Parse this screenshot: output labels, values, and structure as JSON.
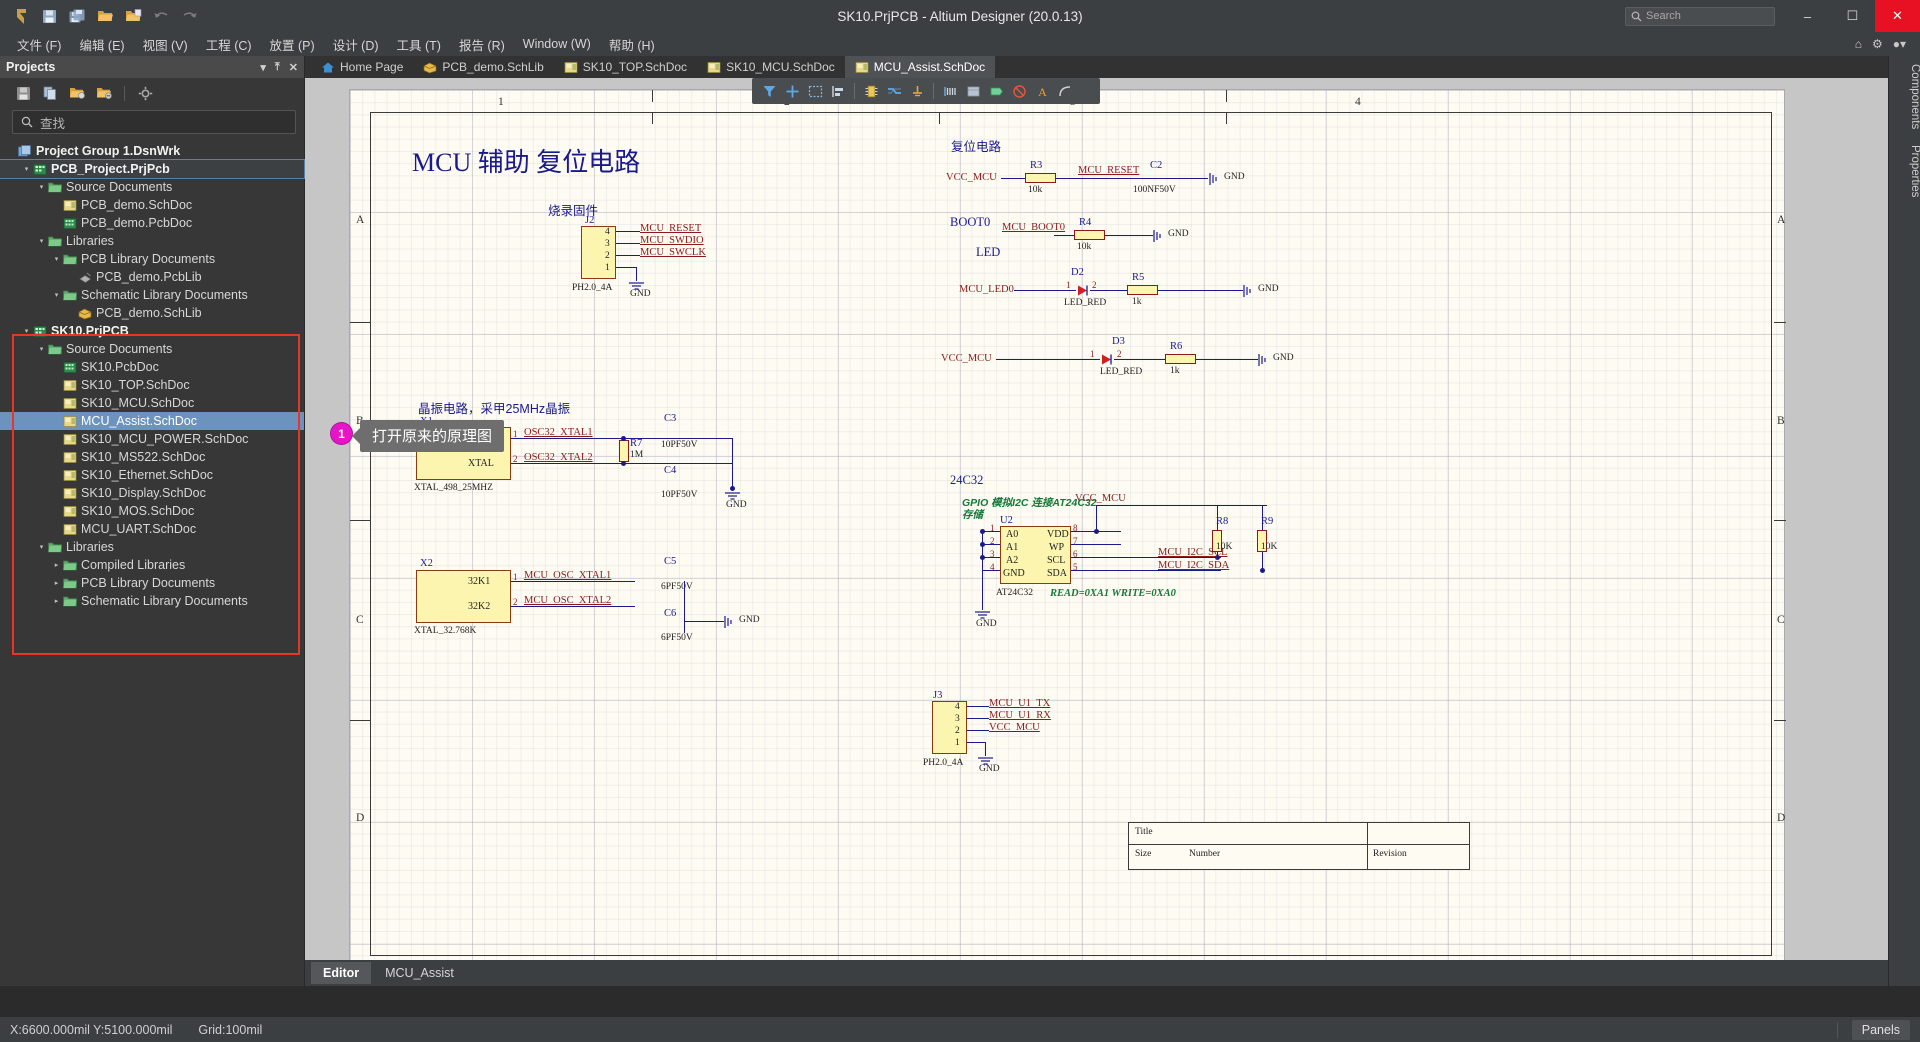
{
  "window": {
    "title": "SK10.PrjPCB - Altium Designer (20.0.13)",
    "search_placeholder": "Search",
    "minimize": "–",
    "maximize": "☐",
    "close": "✕"
  },
  "quick_toolbar": [
    {
      "name": "altium-logo-icon",
      "label": "A"
    },
    {
      "name": "save-icon",
      "label": "Save"
    },
    {
      "name": "save-all-icon",
      "label": "Save All"
    },
    {
      "name": "open-folder-icon",
      "label": "Open"
    },
    {
      "name": "open-project-icon",
      "label": "Open Project"
    },
    {
      "name": "undo-icon",
      "label": "Undo"
    },
    {
      "name": "redo-icon",
      "label": "Redo"
    }
  ],
  "menu": {
    "items": [
      "文件 (F)",
      "编辑 (E)",
      "视图 (V)",
      "工程 (C)",
      "放置 (P)",
      "设计 (D)",
      "工具 (T)",
      "报告 (R)",
      "Window (W)",
      "帮助 (H)"
    ]
  },
  "panel": {
    "title": "Projects",
    "header_controls": [
      "▾",
      "⤒",
      "✕"
    ],
    "toolbar_icons": [
      "save-icon",
      "copy-icon",
      "open-folder-add-icon",
      "open-folder-minus-icon",
      "gear-icon"
    ],
    "search_placeholder": "查找",
    "tree": [
      {
        "depth": 0,
        "label": "Project Group 1.DsnWrk",
        "icon": "workspace-icon",
        "bold": true,
        "arrow": "",
        "state": "normal"
      },
      {
        "depth": 1,
        "label": "PCB_Project.PrjPcb",
        "icon": "pcb-project-icon",
        "bold": true,
        "arrow": "▾",
        "state": "outlined"
      },
      {
        "depth": 2,
        "label": "Source Documents",
        "icon": "folder-icon",
        "bold": false,
        "arrow": "▾",
        "state": "normal"
      },
      {
        "depth": 3,
        "label": "PCB_demo.SchDoc",
        "icon": "schdoc-icon",
        "bold": false,
        "arrow": "",
        "state": "normal"
      },
      {
        "depth": 3,
        "label": "PCB_demo.PcbDoc",
        "icon": "pcbdoc-icon",
        "bold": false,
        "arrow": "",
        "state": "normal"
      },
      {
        "depth": 2,
        "label": "Libraries",
        "icon": "folder-icon",
        "bold": false,
        "arrow": "▾",
        "state": "normal"
      },
      {
        "depth": 3,
        "label": "PCB Library Documents",
        "icon": "folder-icon",
        "bold": false,
        "arrow": "▾",
        "state": "normal"
      },
      {
        "depth": 4,
        "label": "PCB_demo.PcbLib",
        "icon": "pcblib-icon",
        "bold": false,
        "arrow": "",
        "state": "normal"
      },
      {
        "depth": 3,
        "label": "Schematic Library Documents",
        "icon": "folder-icon",
        "bold": false,
        "arrow": "▾",
        "state": "normal"
      },
      {
        "depth": 4,
        "label": "PCB_demo.SchLib",
        "icon": "schlib-icon",
        "bold": false,
        "arrow": "",
        "state": "normal"
      },
      {
        "depth": 1,
        "label": "SK10.PrjPCB",
        "icon": "pcb-project-icon",
        "bold": true,
        "arrow": "▾",
        "state": "normal"
      },
      {
        "depth": 2,
        "label": "Source Documents",
        "icon": "folder-icon",
        "bold": false,
        "arrow": "▾",
        "state": "normal"
      },
      {
        "depth": 3,
        "label": "SK10.PcbDoc",
        "icon": "pcbdoc-icon",
        "bold": false,
        "arrow": "",
        "state": "normal"
      },
      {
        "depth": 3,
        "label": "SK10_TOP.SchDoc",
        "icon": "schdoc-icon",
        "bold": false,
        "arrow": "",
        "state": "normal"
      },
      {
        "depth": 3,
        "label": "SK10_MCU.SchDoc",
        "icon": "schdoc-icon",
        "bold": false,
        "arrow": "",
        "state": "normal"
      },
      {
        "depth": 3,
        "label": "MCU_Assist.SchDoc",
        "icon": "schdoc-icon",
        "bold": false,
        "arrow": "",
        "state": "selected"
      },
      {
        "depth": 3,
        "label": "SK10_MCU_POWER.SchDoc",
        "icon": "schdoc-icon",
        "bold": false,
        "arrow": "",
        "state": "normal"
      },
      {
        "depth": 3,
        "label": "SK10_MS522.SchDoc",
        "icon": "schdoc-icon",
        "bold": false,
        "arrow": "",
        "state": "normal"
      },
      {
        "depth": 3,
        "label": "SK10_Ethernet.SchDoc",
        "icon": "schdoc-icon",
        "bold": false,
        "arrow": "",
        "state": "normal"
      },
      {
        "depth": 3,
        "label": "SK10_Display.SchDoc",
        "icon": "schdoc-icon",
        "bold": false,
        "arrow": "",
        "state": "normal"
      },
      {
        "depth": 3,
        "label": "SK10_MOS.SchDoc",
        "icon": "schdoc-icon",
        "bold": false,
        "arrow": "",
        "state": "normal"
      },
      {
        "depth": 3,
        "label": "MCU_UART.SchDoc",
        "icon": "schdoc-icon",
        "bold": false,
        "arrow": "",
        "state": "normal"
      },
      {
        "depth": 2,
        "label": "Libraries",
        "icon": "folder-icon",
        "bold": false,
        "arrow": "▾",
        "state": "normal"
      },
      {
        "depth": 3,
        "label": "Compiled Libraries",
        "icon": "folder-icon",
        "bold": false,
        "arrow": "▸",
        "state": "normal"
      },
      {
        "depth": 3,
        "label": "PCB Library Documents",
        "icon": "folder-icon",
        "bold": false,
        "arrow": "▸",
        "state": "normal"
      },
      {
        "depth": 3,
        "label": "Schematic Library Documents",
        "icon": "folder-icon",
        "bold": false,
        "arrow": "▸",
        "state": "normal"
      }
    ],
    "highlight_color": "#e8352a"
  },
  "doc_tabs": [
    {
      "label": "Home Page",
      "icon": "home-icon",
      "active": false
    },
    {
      "label": "PCB_demo.SchLib",
      "icon": "schlib-icon",
      "active": false
    },
    {
      "label": "SK10_TOP.SchDoc",
      "icon": "schdoc-icon",
      "active": false
    },
    {
      "label": "SK10_MCU.SchDoc",
      "icon": "schdoc-icon",
      "active": false
    },
    {
      "label": "MCU_Assist.SchDoc",
      "icon": "schdoc-icon",
      "active": true
    }
  ],
  "sch_toolbar_icons": [
    "filter-icon",
    "place-wire-icon",
    "select-area-icon",
    "align-icon",
    "place-part-icon",
    "place-bus-icon",
    "place-power-port-icon",
    "place-net-label-icon",
    "place-sheet-symbol-icon",
    "place-port-icon",
    "place-no-erc-icon",
    "place-text-icon",
    "place-arc-icon"
  ],
  "callout": {
    "number": "1",
    "text": "打开原来的原理图",
    "badge_color": "#e516c8"
  },
  "schematic": {
    "title": "MCU 辅助 复位电路",
    "col_numbers": [
      "1",
      "2",
      "3",
      "4"
    ],
    "row_letters": [
      "A",
      "B",
      "C",
      "D"
    ],
    "sections": {
      "firmware": "烧录固件",
      "reset": "复位电路",
      "boot0": "BOOT0",
      "led": "LED",
      "eeprom": "24C32",
      "eeprom_note1": "GPIO 模拟I2C 连接AT24C32",
      "eeprom_note2": "存储",
      "crystal_note": "晶振电路，采甲25MHz晶振"
    },
    "components": [
      {
        "ref": "J2",
        "value": "PH2.0_4A",
        "pins": [
          "4",
          "3",
          "2",
          "1"
        ],
        "nets": [
          "MCU_RESET",
          "MCU_SWDIO",
          "MCU_SWCLK",
          "GND"
        ]
      },
      {
        "ref": "R3",
        "value": "10k",
        "net_left": "VCC_MCU",
        "net_right": "MCU_RESET"
      },
      {
        "ref": "C2",
        "value": "100NF50V",
        "net_right": "GND"
      },
      {
        "ref": "R4",
        "value": "10k",
        "net_left": "MCU_BOOT0",
        "net_right": "GND"
      },
      {
        "ref": "D2",
        "value": "LED_RED",
        "pins": [
          "1",
          "2"
        ],
        "net_left": "MCU_LED0"
      },
      {
        "ref": "R5",
        "value": "1k",
        "net_right": "GND"
      },
      {
        "ref": "D3",
        "value": "LED_RED",
        "pins": [
          "1",
          "2"
        ],
        "net_left": "VCC_MCU"
      },
      {
        "ref": "R6",
        "value": "1k",
        "net_right": "GND"
      },
      {
        "ref": "X1",
        "value": "XTAL_498_25MHZ",
        "pins": [
          "XTAL",
          "XTAL"
        ],
        "nets": [
          "OSC32_XTAL1",
          "OSC32_XTAL2"
        ],
        "pin_numbers": [
          "1",
          "2"
        ]
      },
      {
        "ref": "R7",
        "value": "1M"
      },
      {
        "ref": "C3",
        "value": "10PF50V"
      },
      {
        "ref": "C4",
        "value": "10PF50V"
      },
      {
        "ref": "X2",
        "value": "XTAL_32.768K",
        "pins": [
          "32K1",
          "32K2"
        ],
        "nets": [
          "MCU_OSC_XTAL1",
          "MCU_OSC_XTAL2"
        ],
        "pin_numbers": [
          "1",
          "2"
        ]
      },
      {
        "ref": "C5",
        "value": "6PF50V"
      },
      {
        "ref": "C6",
        "value": "6PF50V"
      },
      {
        "ref": "U2",
        "value": "AT24C32",
        "footnote": "READ=0XA1 WRITE=0XA0",
        "pins_left": [
          "A0",
          "A1",
          "A2",
          "GND"
        ],
        "pins_right": [
          "VDD",
          "WP",
          "SCL",
          "SDA"
        ],
        "pin_nums_left": [
          "1",
          "2",
          "3",
          "4"
        ],
        "pin_nums_right": [
          "8",
          "7",
          "6",
          "5"
        ],
        "nets_right": [
          "MCU_I2C_SCL",
          "MCU_I2C_SDA"
        ],
        "net_top": "VCC_MCU"
      },
      {
        "ref": "R8",
        "value": "10K"
      },
      {
        "ref": "R9",
        "value": "10K"
      },
      {
        "ref": "J3",
        "value": "PH2.0_4A",
        "pins": [
          "4",
          "3",
          "2",
          "1"
        ],
        "nets": [
          "MCU_U1_TX",
          "MCU_U1_RX",
          "VCC_MCU",
          "GND"
        ]
      }
    ],
    "titleblock": {
      "title_label": "Title",
      "size_label": "Size",
      "number_label": "Number",
      "revision_label": "Revision"
    }
  },
  "bottom_tabs": [
    {
      "label": "Editor",
      "active": true
    },
    {
      "label": "MCU_Assist",
      "active": false
    }
  ],
  "right_rail": [
    "Components",
    "Properties"
  ],
  "status_bar": {
    "coords": "X:6600.000mil Y:5100.000mil",
    "grid": "Grid:100mil",
    "panels_button": "Panels"
  }
}
